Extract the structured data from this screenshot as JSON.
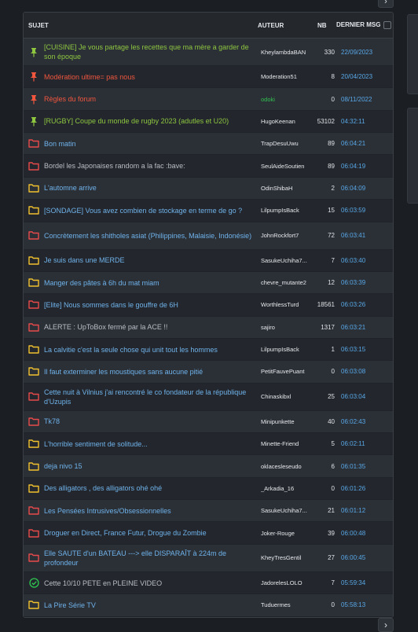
{
  "header": {
    "subject": "SUJET",
    "author": "AUTEUR",
    "nb": "NB",
    "last_msg": "DERNIER MSG"
  },
  "colors": {
    "pinned_green": "#8ec63f",
    "pinned_red": "#f0553e",
    "folder_red": "#e84a4a",
    "folder_yellow": "#f2c12e",
    "resolved": "#2ec44f",
    "link": "#6fb2ea",
    "date": "#58a7e6"
  },
  "topics": [
    {
      "subject": "[CUISINE] Je vous partage les recettes que ma mère a garder de son époque",
      "author": "KheylambdaBAN",
      "nb": "330",
      "date": "22/09/2023",
      "icon": "pin-icon-green"
    },
    {
      "subject": "Modération ultime= pas nous",
      "author": "Moderation51",
      "nb": "8",
      "date": "20/04/2023",
      "icon": "pin-icon-red"
    },
    {
      "subject": "Règles du forum",
      "author": "odoki",
      "nb": "0",
      "date": "08/11/2022",
      "icon": "pin-icon-red"
    },
    {
      "subject": "[RUGBY] Coupe du monde de rugby 2023 (adutles et U20)",
      "author": "HugoKeenan",
      "nb": "53102",
      "date": "04:32:11",
      "icon": "pin-icon-green"
    },
    {
      "subject": "Bon matin",
      "author": "TrapDesuUwu",
      "nb": "89",
      "date": "06:04:21",
      "icon": "folder-red-icon"
    },
    {
      "subject": "Bordel les Japonaises random a la fac :bave:",
      "author": "SeulAideSoutien",
      "nb": "89",
      "date": "06:04:19",
      "icon": "folder-red-icon"
    },
    {
      "subject": "L'automne arrive",
      "author": "OdinShibaH",
      "nb": "2",
      "date": "06:04:09",
      "icon": "folder-yellow-icon"
    },
    {
      "subject": "[SONDAGE] Vous avez combien de stockage en terme de go ?",
      "author": "LilpumpIsBack",
      "nb": "15",
      "date": "06:03:59",
      "icon": "folder-yellow-icon"
    },
    {
      "subject": "Concrètement les shitholes asiat (Philippines, Malaisie, Indonésie)",
      "author": "JohnRockfort7",
      "nb": "72",
      "date": "06:03:41",
      "icon": "folder-red-icon"
    },
    {
      "subject": "Je suis dans une MERDE",
      "author": "SasukeUchiha7...",
      "nb": "7",
      "date": "06:03:40",
      "icon": "folder-yellow-icon"
    },
    {
      "subject": "Manger des pâtes à 6h du mat miam",
      "author": "chevre_mutante2",
      "nb": "12",
      "date": "06:03:39",
      "icon": "folder-yellow-icon"
    },
    {
      "subject": "[Elite] Nous sommes dans le gouffre de 6H",
      "author": "WorthlessTurd",
      "nb": "18561",
      "date": "06:03:26",
      "icon": "folder-red-icon"
    },
    {
      "subject": "ALERTE : UpToBox fermé par la ACE !!",
      "author": "sajiro",
      "nb": "1317",
      "date": "06:03:21",
      "icon": "folder-red-icon"
    },
    {
      "subject": "La calvitie c'est la seule chose qui unit tout les hommes",
      "author": "LilpumpIsBack",
      "nb": "1",
      "date": "06:03:15",
      "icon": "folder-yellow-icon"
    },
    {
      "subject": "Il faut exterminer les moustiques sans aucune pitié",
      "author": "PetitFauvePuant",
      "nb": "0",
      "date": "06:03:08",
      "icon": "folder-yellow-icon"
    },
    {
      "subject": "Cette nuit à Vilnius j'ai rencontré le co fondateur de la république d'Uzupis",
      "author": "Chinaskibxl",
      "nb": "25",
      "date": "06:03:04",
      "icon": "folder-red-icon"
    },
    {
      "subject": "Tk78",
      "author": "Minipunkette",
      "nb": "40",
      "date": "06:02:43",
      "icon": "folder-red-icon"
    },
    {
      "subject": "L'horrible sentiment de solitude...",
      "author": "Minette-Friend",
      "nb": "5",
      "date": "06:02:11",
      "icon": "folder-yellow-icon"
    },
    {
      "subject": "deja nivo 15",
      "author": "oklacesleseudo",
      "nb": "6",
      "date": "06:01:35",
      "icon": "folder-yellow-icon"
    },
    {
      "subject": "Des alligators , des alligators ohé ohé",
      "author": "_Arkadia_16",
      "nb": "0",
      "date": "06:01:26",
      "icon": "folder-yellow-icon"
    },
    {
      "subject": "Les Pensées Intrusives/Obsessionnelles",
      "author": "SasukeUchiha7...",
      "nb": "21",
      "date": "06:01:12",
      "icon": "folder-red-icon"
    },
    {
      "subject": "Droguer en Direct, France Futur, Drogue du Zombie",
      "author": "Joker-Rouge",
      "nb": "39",
      "date": "06:00:48",
      "icon": "folder-red-icon"
    },
    {
      "subject": "Elle SAUTE d'un BATEAU ---> elle DISPARAÎT à 224m de profondeur",
      "author": "KheyTresGentil",
      "nb": "27",
      "date": "06:00:45",
      "icon": "folder-red-icon"
    },
    {
      "subject": "Cette 10/10 PETE en PLEINE VIDEO",
      "author": "JadorelesLOLO",
      "nb": "7",
      "date": "05:59:34",
      "icon": "check-circle-icon"
    },
    {
      "subject": "La Pire Série TV",
      "author": "Tuduermes",
      "nb": "0",
      "date": "05:58:13",
      "icon": "folder-yellow-icon"
    }
  ],
  "nav": {
    "prev_label": "›",
    "next_label": "›"
  }
}
